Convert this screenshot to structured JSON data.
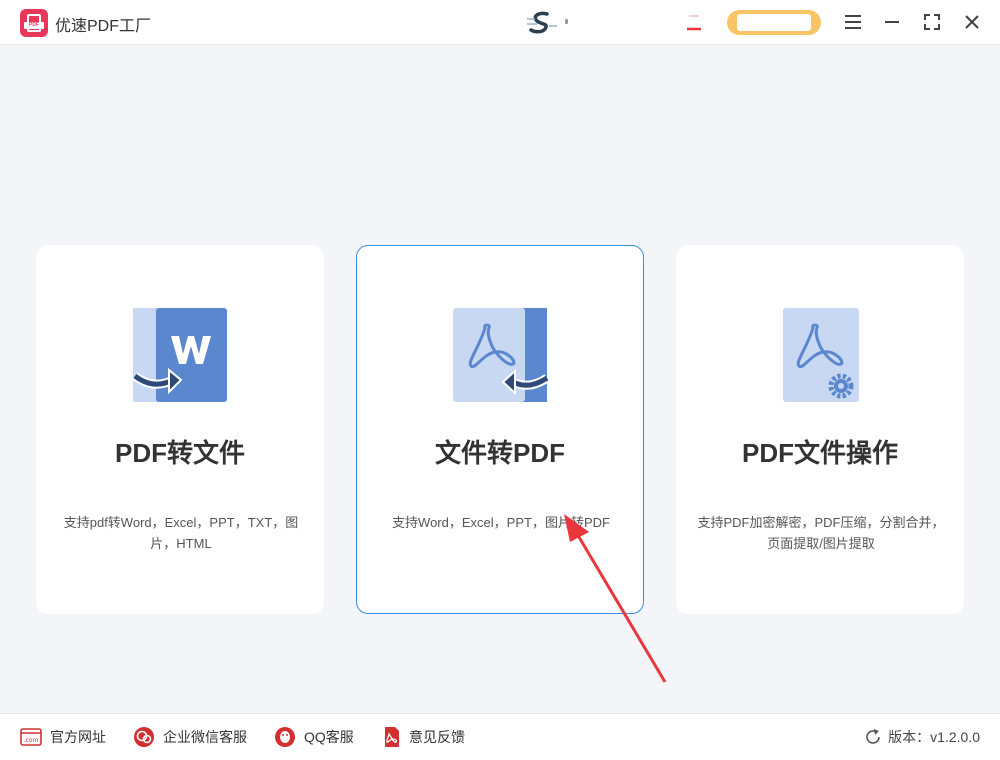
{
  "app": {
    "title": "优速PDF工厂",
    "logo_text": "PDF"
  },
  "colors": {
    "accent": "#e8385a",
    "card_border_active": "#3a8fe0",
    "icon_blue": "#5b87cf",
    "icon_light": "#c8d8f2",
    "vip_pill": "#f9c463",
    "arrow": "#e8383d"
  },
  "window_controls": [
    "menu-icon",
    "minimize-icon",
    "maximize-icon",
    "close-icon"
  ],
  "cards": [
    {
      "title": "PDF转文件",
      "desc": "支持pdf转Word，Excel，PPT，TXT，图片，HTML",
      "icon": "pdf-to-word-icon",
      "active": false
    },
    {
      "title": "文件转PDF",
      "desc": "支持Word，Excel，PPT，图片转PDF",
      "icon": "file-to-pdf-icon",
      "active": true
    },
    {
      "title": "PDF文件操作",
      "desc": "支持PDF加密解密，PDF压缩，分割合并，页面提取/图片提取",
      "icon": "pdf-operations-icon",
      "active": false
    }
  ],
  "footer": {
    "links": [
      {
        "label": "官方网址",
        "icon": "website-icon"
      },
      {
        "label": "企业微信客服",
        "icon": "wechat-service-icon"
      },
      {
        "label": "QQ客服",
        "icon": "qq-icon"
      },
      {
        "label": "意见反馈",
        "icon": "feedback-icon"
      }
    ],
    "version": "版本：v1.2.0.0"
  }
}
